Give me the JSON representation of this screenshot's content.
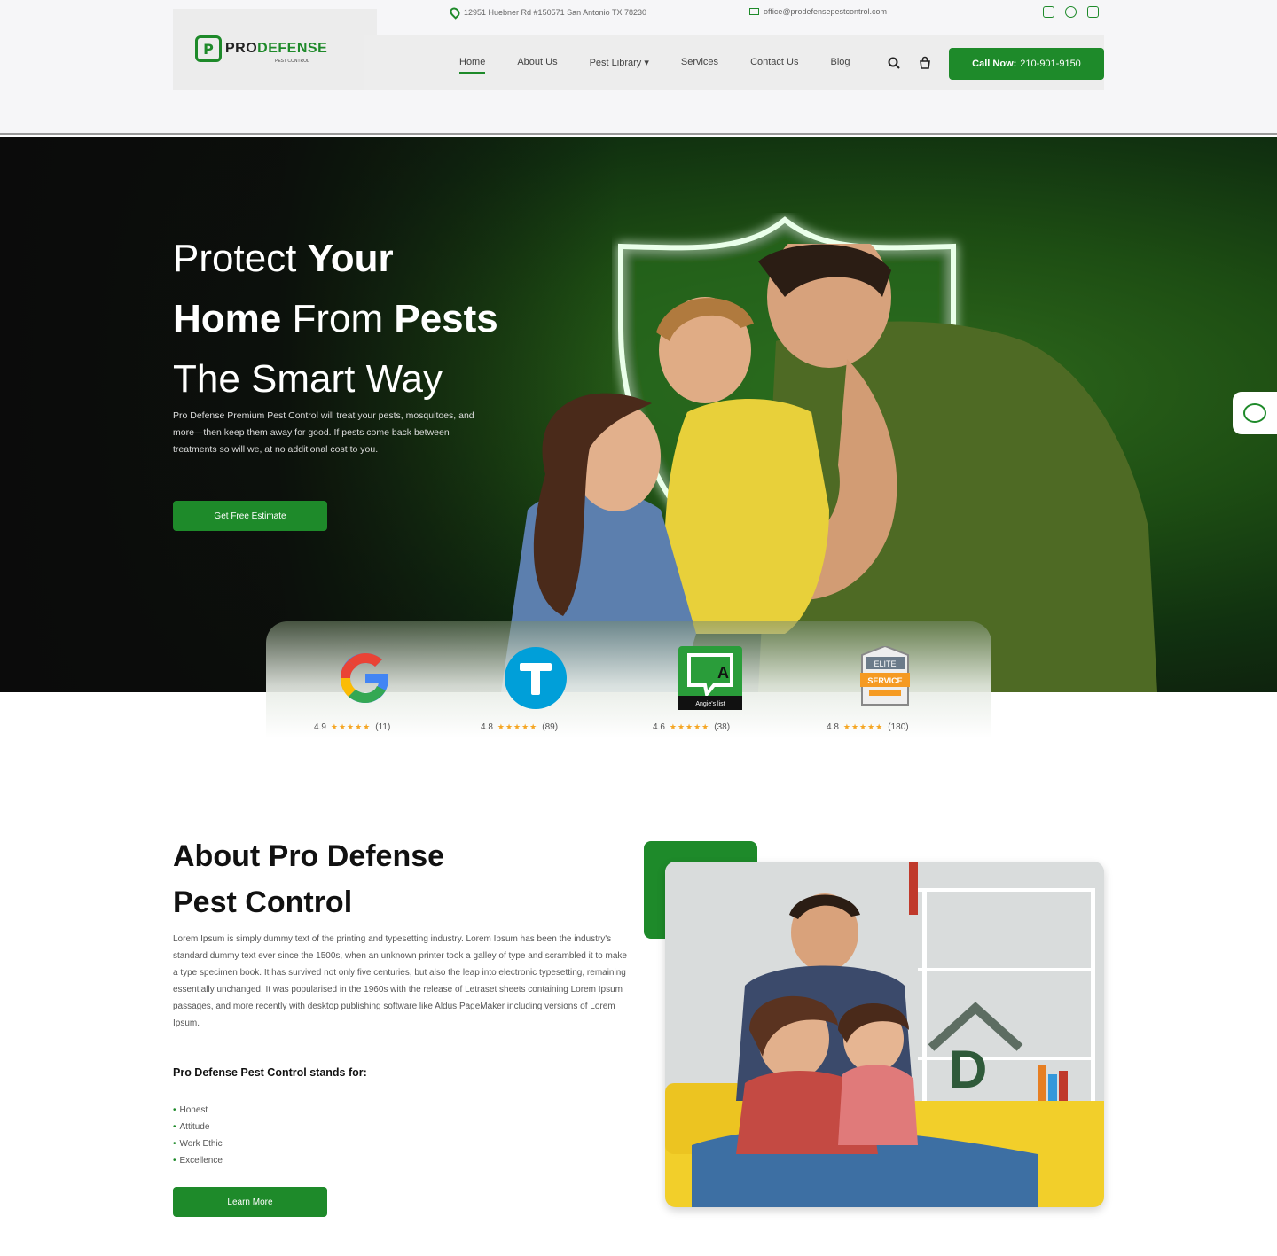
{
  "topbar": {
    "address": "12951 Huebner Rd #150571 San Antonio TX 78230",
    "email": "office@prodefensepestcontrol.com",
    "social_icons": [
      "instagram-icon",
      "facebook-icon",
      "youtube-icon"
    ]
  },
  "logo": {
    "pro": "PRO",
    "defense": "DEFENSE",
    "sub": "PEST CONTROL",
    "mark": "P"
  },
  "nav": {
    "items": [
      {
        "label": "Home",
        "active": true
      },
      {
        "label": "About Us"
      },
      {
        "label": "Pest Library ▾"
      },
      {
        "label": "Services"
      },
      {
        "label": "Contact Us"
      },
      {
        "label": "Blog"
      }
    ],
    "call_label": "Call Now:",
    "call_number": "210-901-9150"
  },
  "hero": {
    "line1_light": "Protect ",
    "line1_bold": "Your",
    "line2_bold": "Home",
    "line2_light": " From ",
    "line2_bold2": "Pests",
    "line3": "The Smart Way",
    "description": "Pro Defense Premium Pest Control will treat your pests, mosquitoes, and more—then keep them away for good. If pests come back between treatments so will we, at no additional cost to you.",
    "cta": "Get Free Estimate"
  },
  "reviews": [
    {
      "name": "google-icon",
      "rating": "4.9",
      "stars": "★★★★★",
      "count": "(11)"
    },
    {
      "name": "thumbtack-icon",
      "rating": "4.8",
      "stars": "★★★★★",
      "count": "(89)"
    },
    {
      "name": "angies-list-icon",
      "rating": "4.6",
      "stars": "★★★★★",
      "count": "(38)",
      "badge_text": "Angie's list"
    },
    {
      "name": "homeadvisor-elite-icon",
      "rating": "4.8",
      "stars": "★★★★★",
      "count": "(180)",
      "badge_top": "ELITE",
      "badge_mid": "SERVICE"
    }
  ],
  "about": {
    "title_light1": "About ",
    "title_bold1": "Pro",
    "title_light2": " Defense",
    "title_bold2": "Pest",
    "title_light3": " Control",
    "body": "Lorem Ipsum is simply dummy text of the printing and typesetting industry. Lorem Ipsum has been the industry's standard dummy text ever since the 1500s, when an unknown printer took a galley of type and scrambled it to make a type specimen book. It has survived not only five centuries, but also the leap into electronic typesetting, remaining essentially unchanged. It was popularised in the 1960s with the release of Letraset sheets containing Lorem Ipsum passages, and more recently with desktop publishing software like Aldus PageMaker including versions of Lorem Ipsum.",
    "stands_for": "Pro Defense Pest Control stands for:",
    "values": [
      "Honest",
      "Attitude",
      "Work Ethic",
      "Excellence"
    ],
    "cta": "Learn More"
  },
  "colors": {
    "brand_green": "#1e8a2a",
    "star": "#f5a623"
  }
}
